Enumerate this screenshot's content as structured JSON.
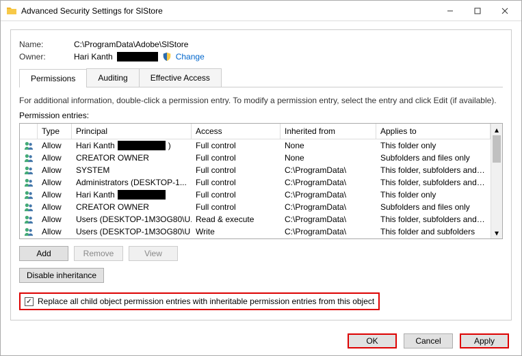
{
  "window": {
    "title": "Advanced Security Settings for SlStore"
  },
  "header": {
    "name_label": "Name:",
    "name_value": "C:\\ProgramData\\Adobe\\SlStore",
    "owner_label": "Owner:",
    "owner_value": "Hari Kanth",
    "change": "Change"
  },
  "tabs": {
    "permissions": "Permissions",
    "auditing": "Auditing",
    "effective": "Effective Access"
  },
  "info_text": "For additional information, double-click a permission entry. To modify a permission entry, select the entry and click Edit (if available).",
  "entries_label": "Permission entries:",
  "columns": {
    "type": "Type",
    "principal": "Principal",
    "access": "Access",
    "inherited": "Inherited from",
    "applies": "Applies to"
  },
  "rows": [
    {
      "type": "Allow",
      "principal": "Hari Kanth",
      "principal_suffix": ")",
      "access": "Full control",
      "inherited": "None",
      "applies": "This folder only"
    },
    {
      "type": "Allow",
      "principal": "CREATOR OWNER",
      "access": "Full control",
      "inherited": "None",
      "applies": "Subfolders and files only"
    },
    {
      "type": "Allow",
      "principal": "SYSTEM",
      "access": "Full control",
      "inherited": "C:\\ProgramData\\",
      "applies": "This folder, subfolders and files"
    },
    {
      "type": "Allow",
      "principal": "Administrators (DESKTOP-1...",
      "access": "Full control",
      "inherited": "C:\\ProgramData\\",
      "applies": "This folder, subfolders and files"
    },
    {
      "type": "Allow",
      "principal": "Hari Kanth",
      "access": "Full control",
      "inherited": "C:\\ProgramData\\",
      "applies": "This folder only"
    },
    {
      "type": "Allow",
      "principal": "CREATOR OWNER",
      "access": "Full control",
      "inherited": "C:\\ProgramData\\",
      "applies": "Subfolders and files only"
    },
    {
      "type": "Allow",
      "principal": "Users (DESKTOP-1M3OG80\\U...",
      "access": "Read & execute",
      "inherited": "C:\\ProgramData\\",
      "applies": "This folder, subfolders and files"
    },
    {
      "type": "Allow",
      "principal": "Users (DESKTOP-1M3OG80\\U",
      "access": "Write",
      "inherited": "C:\\ProgramData\\",
      "applies": "This folder and subfolders"
    }
  ],
  "buttons": {
    "add": "Add",
    "remove": "Remove",
    "view": "View",
    "disable_inherit": "Disable inheritance",
    "ok": "OK",
    "cancel": "Cancel",
    "apply": "Apply"
  },
  "checkbox": {
    "checked": "✓",
    "label": "Replace all child object permission entries with inheritable permission entries from this object"
  }
}
